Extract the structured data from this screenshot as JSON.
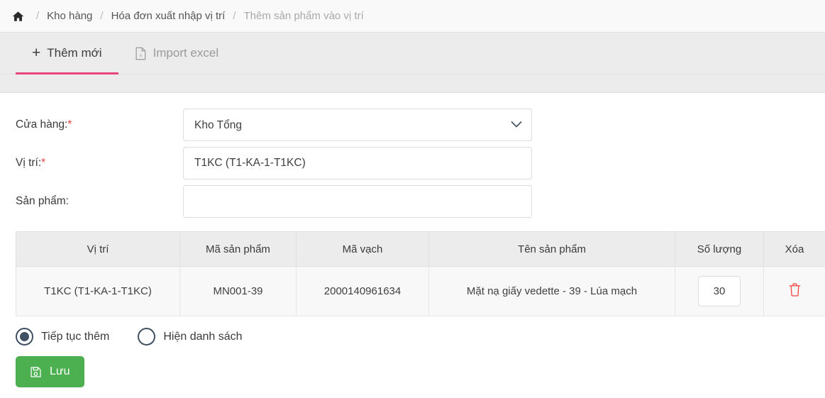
{
  "breadcrumb": {
    "home_icon": "home-icon",
    "separator": "/",
    "items": [
      {
        "label": "Kho hàng",
        "muted": false
      },
      {
        "label": "Hóa đơn xuất nhập vị trí",
        "muted": false
      },
      {
        "label": "Thêm sản phẩm vào vị trí",
        "muted": true
      }
    ]
  },
  "tabs": [
    {
      "label": "Thêm mới",
      "icon": "plus-icon",
      "active": true
    },
    {
      "label": "Import excel",
      "icon": "excel-file-icon",
      "active": false
    }
  ],
  "form": {
    "store": {
      "label": "Cửa hàng:",
      "required": "*",
      "value": "Kho Tổng",
      "options": [
        "Kho Tổng"
      ],
      "icon": "chevron-down-icon"
    },
    "location": {
      "label": "Vị trí:",
      "required": "*",
      "value": "T1KC (T1-KA-1-T1KC)",
      "placeholder": ""
    },
    "product": {
      "label": "Sản phẩm:",
      "required": "",
      "value": "",
      "placeholder": ""
    }
  },
  "table": {
    "columns": [
      "Vị trí",
      "Mã sản phẩm",
      "Mã vạch",
      "Tên sản phẩm",
      "Số lượng",
      "Xóa"
    ],
    "rows": [
      {
        "location": "T1KC (T1-KA-1-T1KC)",
        "product_code": "MN001-39",
        "barcode": "2000140961634",
        "product_name": "Mặt nạ giấy vedette - 39 - Lúa mạch",
        "quantity": "30",
        "delete_icon": "trash-icon"
      }
    ]
  },
  "options": {
    "radios": [
      {
        "label": "Tiếp tục thêm",
        "checked": true
      },
      {
        "label": "Hiện danh sách",
        "checked": false
      }
    ]
  },
  "actions": {
    "save_label": "Lưu",
    "save_icon": "save-floppy-icon"
  },
  "colors": {
    "accent_tab_underline": "#e8467c",
    "save_button": "#4caf50",
    "required_asterisk": "#e8453c",
    "delete_icon": "#ef5350",
    "radio": "#3f5163"
  }
}
